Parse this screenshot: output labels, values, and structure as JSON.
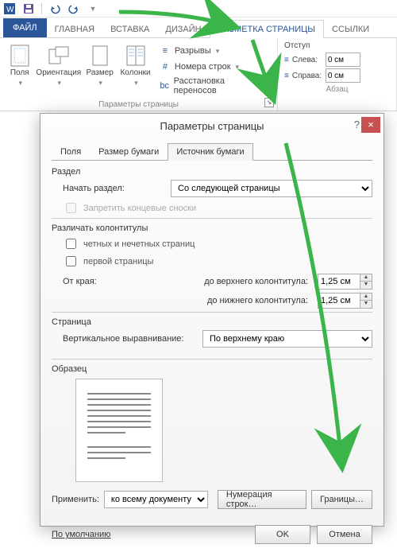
{
  "titlebar": {
    "icons": [
      "word",
      "save",
      "undo",
      "redo",
      "customize"
    ]
  },
  "tabs": {
    "file": "ФАЙЛ",
    "home": "ГЛАВНАЯ",
    "insert": "ВСТАВКА",
    "design": "ДИЗАЙН",
    "page_layout": "РАЗМЕТКА СТРАНИЦЫ",
    "references": "ССЫЛКИ"
  },
  "ribbon": {
    "page_setup": {
      "margins": "Поля",
      "orientation": "Ориентация",
      "size": "Размер",
      "columns": "Колонки",
      "breaks": "Разрывы",
      "line_numbers": "Номера строк",
      "hyphenation": "Расстановка переносов",
      "group_label": "Параметры страницы"
    },
    "indent": {
      "title": "Отступ",
      "left_label": "Слева:",
      "left_value": "0 см",
      "right_label": "Справа:",
      "right_value": "0 см",
      "group_label": "Абзац"
    }
  },
  "dialog": {
    "title": "Параметры страницы",
    "tabs": {
      "margins": "Поля",
      "paper_size": "Размер бумаги",
      "paper_source": "Источник бумаги"
    },
    "section": {
      "label": "Раздел",
      "start_label": "Начать раздел:",
      "start_value": "Со следующей страницы",
      "suppress_endnotes": "Запретить концевые сноски"
    },
    "headers_footers": {
      "label": "Различать колонтитулы",
      "odd_even": "четных и нечетных страниц",
      "first_page": "первой страницы",
      "from_edge": "От края:",
      "header_label": "до верхнего колонтитула:",
      "header_value": "1,25 см",
      "footer_label": "до нижнего колонтитула:",
      "footer_value": "1,25 см"
    },
    "page": {
      "label": "Страница",
      "valign_label": "Вертикальное выравнивание:",
      "valign_value": "По верхнему краю"
    },
    "preview": {
      "label": "Образец"
    },
    "apply": {
      "label": "Применить:",
      "value": "ко всему документу",
      "line_numbers_btn": "Нумерация строк…",
      "borders_btn": "Границы…"
    },
    "footer": {
      "default_btn": "По умолчанию",
      "ok": "OK",
      "cancel": "Отмена"
    }
  }
}
